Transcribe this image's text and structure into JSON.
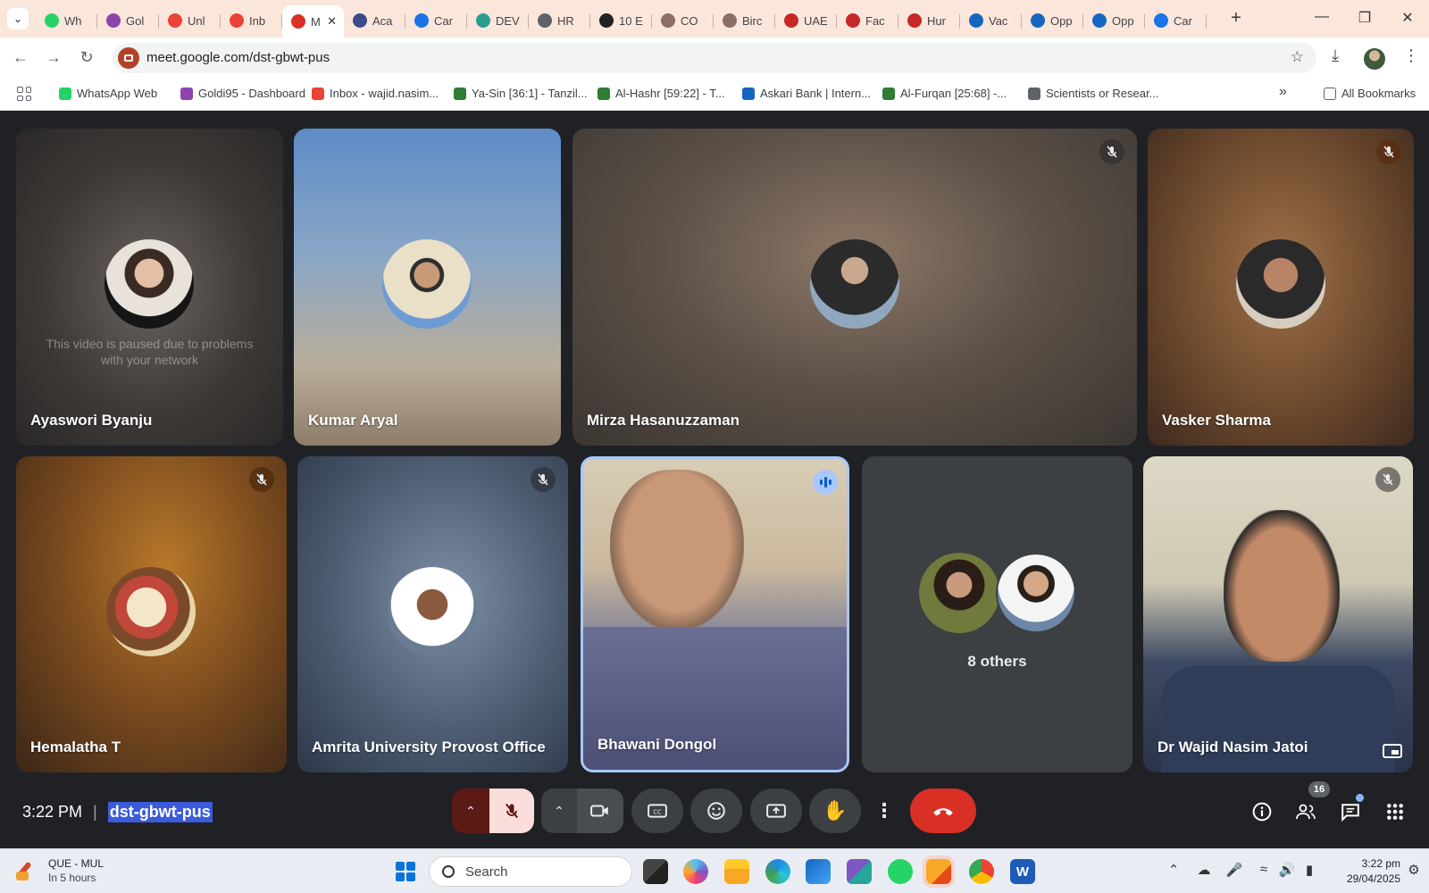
{
  "browser": {
    "tabs": [
      {
        "label": "Wh",
        "color": "#25d366"
      },
      {
        "label": "Gol",
        "color": "#8e44ad"
      },
      {
        "label": "Unl",
        "color": "#ea4335"
      },
      {
        "label": "Inb",
        "color": "#ea4335"
      },
      {
        "label": "M",
        "color": "#d93025",
        "active": true
      },
      {
        "label": "Aca",
        "color": "#3c4a8a"
      },
      {
        "label": "Car",
        "color": "#1a73e8"
      },
      {
        "label": "DEV",
        "color": "#2a9d8f"
      },
      {
        "label": "HR",
        "color": "#5f6368"
      },
      {
        "label": "10 E",
        "color": "#222222"
      },
      {
        "label": "CO",
        "color": "#8d6e63"
      },
      {
        "label": "Birc",
        "color": "#8d6e63"
      },
      {
        "label": "UAE",
        "color": "#c62828"
      },
      {
        "label": "Fac",
        "color": "#c62828"
      },
      {
        "label": "Hur",
        "color": "#c62828"
      },
      {
        "label": "Vac",
        "color": "#1565c0"
      },
      {
        "label": "Opp",
        "color": "#1565c0"
      },
      {
        "label": "Opp",
        "color": "#1565c0"
      },
      {
        "label": "Car",
        "color": "#1a73e8"
      }
    ],
    "url": "meet.google.com/dst-gbwt-pus",
    "bookmarks": [
      {
        "label": "WhatsApp Web",
        "color": "#25d366"
      },
      {
        "label": "Goldi95 - Dashboard",
        "color": "#8e44ad"
      },
      {
        "label": "Inbox - wajid.nasim...",
        "color": "#ea4335"
      },
      {
        "label": "Ya-Sin [36:1] - Tanzil...",
        "color": "#2e7d32"
      },
      {
        "label": "Al-Hashr [59:22] - T...",
        "color": "#2e7d32"
      },
      {
        "label": "Askari Bank | Intern...",
        "color": "#1565c0"
      },
      {
        "label": "Al-Furqan [25:68] -...",
        "color": "#2e7d32"
      },
      {
        "label": "Scientists or Resear...",
        "color": "#5f6368"
      }
    ],
    "all_bookmarks": "All Bookmarks"
  },
  "meet": {
    "paused_message": "This video is paused due to problems with your network",
    "participants": [
      {
        "name": "Ayaswori Byanju"
      },
      {
        "name": "Kumar Aryal"
      },
      {
        "name": "Mirza Hasanuzzaman"
      },
      {
        "name": "Vasker Sharma"
      },
      {
        "name": "Hemalatha T"
      },
      {
        "name": "Amrita University Provost Office"
      },
      {
        "name": "Bhawani Dongol"
      },
      {
        "name": "Dr Wajid Nasim Jatoi"
      }
    ],
    "others_label": "8 others",
    "time": "3:22 PM",
    "separator": "|",
    "meeting_code": "dst-gbwt-pus",
    "participant_count": "16"
  },
  "taskbar": {
    "weather_title": "QUE - MUL",
    "weather_sub": "In 5 hours",
    "search_label": "Search",
    "time": "3:22 pm",
    "date": "29/04/2025"
  }
}
